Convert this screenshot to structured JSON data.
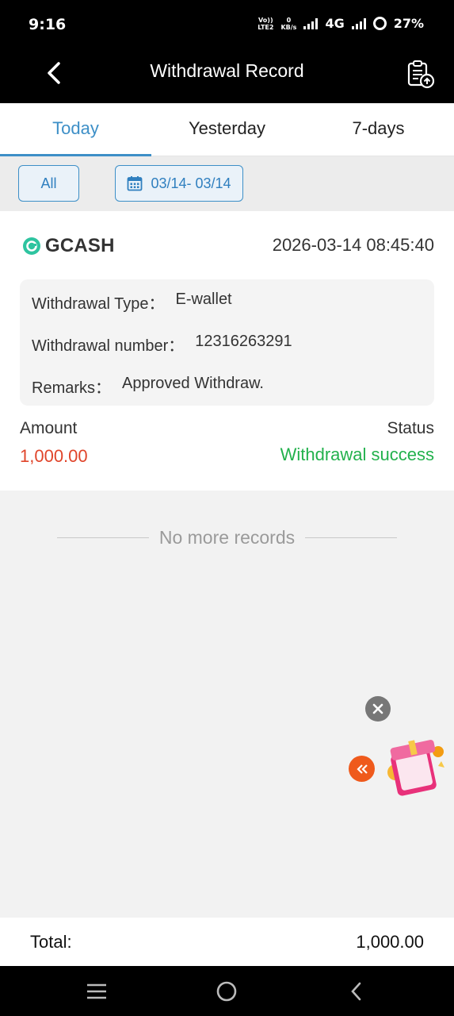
{
  "status_bar": {
    "time": "9:16",
    "volte": "Vo))",
    "lte_label": "LTE2",
    "speed_value": "0",
    "speed_unit": "KB/s",
    "network": "4G",
    "battery": "27%"
  },
  "header": {
    "title": "Withdrawal Record",
    "back_icon": "chevron-left-icon",
    "export_icon": "clipboard-upload-icon"
  },
  "tabs": [
    {
      "label": "Today",
      "active": true
    },
    {
      "label": "Yesterday",
      "active": false
    },
    {
      "label": "7-days",
      "active": false
    }
  ],
  "filters": {
    "type_label": "All",
    "date_range": "03/14- 03/14",
    "date_icon": "calendar-icon"
  },
  "record": {
    "method": "GCASH",
    "timestamp": "2026-03-14 08:45:40",
    "withdrawal_type_label": "Withdrawal Type：",
    "withdrawal_type_value": "E-wallet",
    "withdrawal_number_label": "Withdrawal number：",
    "withdrawal_number_value": "12316263291",
    "remarks_label": "Remarks：",
    "remarks_value": "Approved Withdraw.",
    "amount_label": "Amount",
    "amount_value": "1,000.00",
    "status_label": "Status",
    "status_value": "Withdrawal success"
  },
  "list_end_text": "No more records",
  "footer": {
    "total_label": "Total:",
    "total_value": "1,000.00"
  },
  "colors": {
    "accent": "#3d8fc7",
    "amount": "#e0452b",
    "success": "#22b14c",
    "gcash": "#2ec4a0"
  }
}
